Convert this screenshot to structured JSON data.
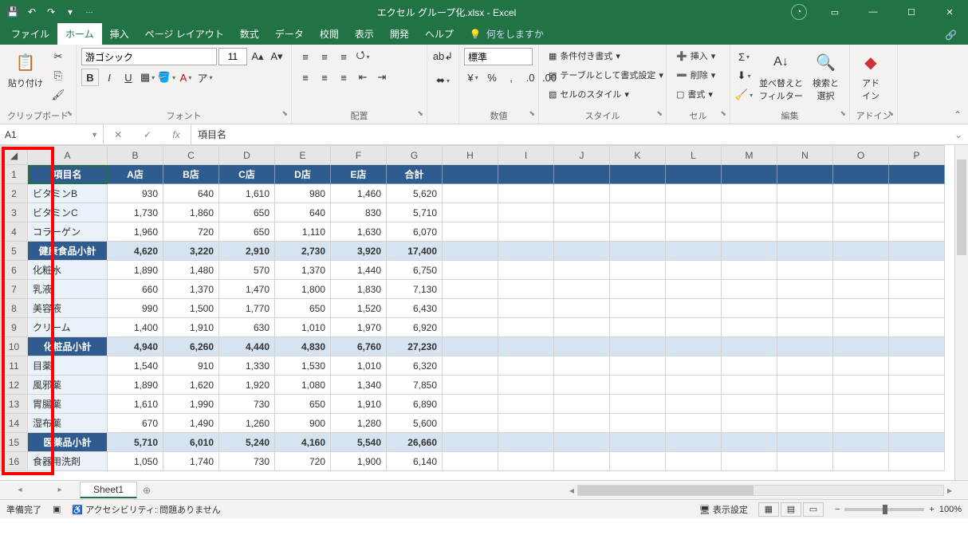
{
  "title": "エクセル グループ化.xlsx  -  Excel",
  "tabs": {
    "file": "ファイル",
    "home": "ホーム",
    "insert": "挿入",
    "layout": "ページ レイアウト",
    "formulas": "数式",
    "data": "データ",
    "review": "校閲",
    "view": "表示",
    "dev": "開発",
    "help": "ヘルプ",
    "tellme": "何をしますか"
  },
  "ribbon": {
    "paste": "貼り付け",
    "clipboard": "クリップボード",
    "font_name": "游ゴシック",
    "font_size": "11",
    "font": "フォント",
    "align": "配置",
    "wrap": "折り返して全体を表示する",
    "merge": "セルを結合して中央揃え",
    "number_format": "標準",
    "number": "数値",
    "cond": "条件付き書式",
    "tblfmt": "テーブルとして書式設定",
    "cellsty": "セルのスタイル",
    "styles": "スタイル",
    "ins": "挿入",
    "del": "削除",
    "fmt": "書式",
    "cells": "セル",
    "sortfilter": "並べ替えと\nフィルター",
    "findsel": "検索と\n選択",
    "editing": "編集",
    "addin": "アド\nイン",
    "addins": "アドイン"
  },
  "namebox": "A1",
  "formula": "項目名",
  "columns": [
    "A",
    "B",
    "C",
    "D",
    "E",
    "F",
    "G",
    "H",
    "I",
    "J",
    "K",
    "L",
    "M",
    "N",
    "O",
    "P"
  ],
  "headers": [
    "項目名",
    "A店",
    "B店",
    "C店",
    "D店",
    "E店",
    "合計"
  ],
  "rows": [
    {
      "n": 1,
      "type": "hdr"
    },
    {
      "n": 2,
      "label": "ビタミンB",
      "v": [
        930,
        640,
        1610,
        980,
        1460,
        5620
      ]
    },
    {
      "n": 3,
      "label": "ビタミンC",
      "v": [
        1730,
        1860,
        650,
        640,
        830,
        5710
      ]
    },
    {
      "n": 4,
      "label": "コラーゲン",
      "v": [
        1960,
        720,
        650,
        1110,
        1630,
        6070
      ]
    },
    {
      "n": 5,
      "type": "sub",
      "label": "健康食品小計",
      "v": [
        4620,
        3220,
        2910,
        2730,
        3920,
        17400
      ]
    },
    {
      "n": 6,
      "label": "化粧水",
      "v": [
        1890,
        1480,
        570,
        1370,
        1440,
        6750
      ]
    },
    {
      "n": 7,
      "label": "乳液",
      "v": [
        660,
        1370,
        1470,
        1800,
        1830,
        7130
      ]
    },
    {
      "n": 8,
      "label": "美容液",
      "v": [
        990,
        1500,
        1770,
        650,
        1520,
        6430
      ]
    },
    {
      "n": 9,
      "label": "クリーム",
      "v": [
        1400,
        1910,
        630,
        1010,
        1970,
        6920
      ]
    },
    {
      "n": 10,
      "type": "sub",
      "label": "化粧品小計",
      "v": [
        4940,
        6260,
        4440,
        4830,
        6760,
        27230
      ]
    },
    {
      "n": 11,
      "label": "目薬",
      "v": [
        1540,
        910,
        1330,
        1530,
        1010,
        6320
      ]
    },
    {
      "n": 12,
      "label": "風邪薬",
      "v": [
        1890,
        1620,
        1920,
        1080,
        1340,
        7850
      ]
    },
    {
      "n": 13,
      "label": "胃腸薬",
      "v": [
        1610,
        1990,
        730,
        650,
        1910,
        6890
      ]
    },
    {
      "n": 14,
      "label": "湿布薬",
      "v": [
        670,
        1490,
        1260,
        900,
        1280,
        5600
      ]
    },
    {
      "n": 15,
      "type": "sub",
      "label": "医薬品小計",
      "v": [
        5710,
        6010,
        5240,
        4160,
        5540,
        26660
      ]
    },
    {
      "n": 16,
      "label": "食器用洗剤",
      "v": [
        1050,
        1740,
        730,
        720,
        1900,
        6140
      ]
    }
  ],
  "sheet_tab": "Sheet1",
  "status": {
    "ready": "準備完了",
    "access": "アクセシビリティ: 問題ありません",
    "display": "表示設定",
    "zoom": "100%"
  }
}
